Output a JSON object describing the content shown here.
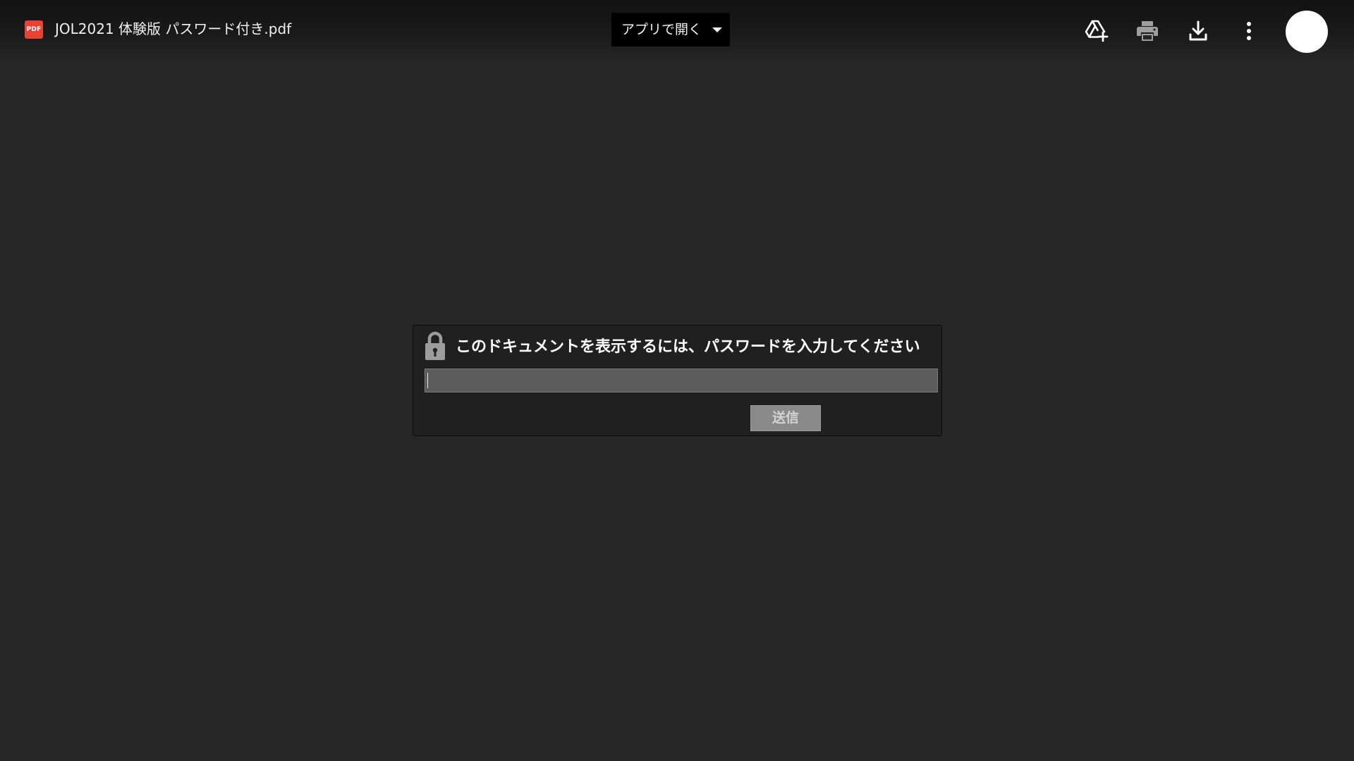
{
  "header": {
    "file_type_badge": "PDF",
    "file_title": "JOL2021 体験版 パスワード付き.pdf",
    "open_with_label": "アプリで開く",
    "icons": {
      "add_to_drive": "add-to-drive-icon",
      "print": "print-icon",
      "download": "download-icon",
      "more": "more-vert-icon"
    }
  },
  "dialog": {
    "message": "このドキュメントを表示するには、パスワードを入力してください",
    "password_value": "",
    "submit_label": "送信"
  },
  "colors": {
    "background": "#262626",
    "pdf_badge": "#e94235",
    "dialog_background": "#202020",
    "input_background": "#5c5c5c",
    "submit_background": "#8a8a8a"
  }
}
